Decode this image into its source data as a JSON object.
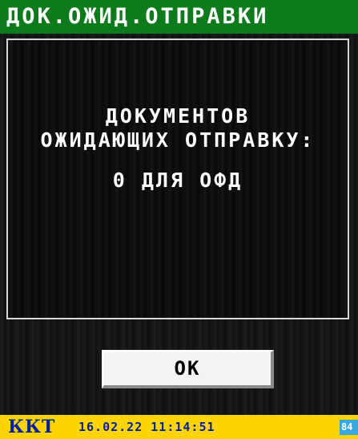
{
  "window": {
    "title": "ДОК.ОЖИД.ОТПРАВКИ"
  },
  "message": {
    "line1": "ДОКУМЕНТОВ",
    "line2": "ОЖИДАЮЩИХ ОТПРАВКУ:",
    "line3": "0 ДЛЯ ОФД"
  },
  "buttons": {
    "ok_label": "OK"
  },
  "status_bar": {
    "device_label": "ККТ",
    "datetime": "16.02.22 11:14:51",
    "badge": "84"
  },
  "colors": {
    "title_bg": "#0d7a1c",
    "status_bg": "#ffd500",
    "status_text": "#00229e",
    "badge_bg": "#3aa8e0"
  }
}
